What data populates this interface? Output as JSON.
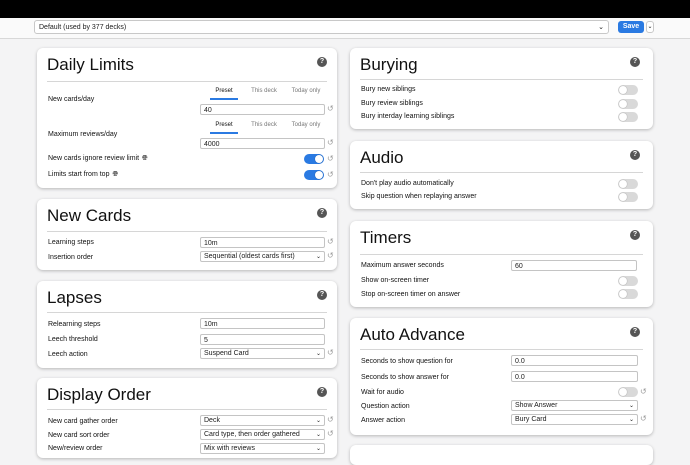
{
  "topbar": {
    "preset": "Default (used by 377 decks)",
    "save_label": "Save",
    "save_menu": "⌄"
  },
  "icons": {
    "help": "help-icon",
    "reset": "revert-icon",
    "globe": "globe-icon",
    "chevron": "chevron-down-icon"
  },
  "colors": {
    "accent": "#2a7ae2"
  },
  "daily_limits": {
    "title": "Daily Limits",
    "tabs": [
      "Preset",
      "This deck",
      "Today only"
    ],
    "new_cards_label": "New cards/day",
    "new_cards_value": "40",
    "max_reviews_label": "Maximum reviews/day",
    "max_reviews_value": "4000",
    "ignore_review_label": "New cards ignore review limit",
    "limits_top_label": "Limits start from top"
  },
  "new_cards": {
    "title": "New Cards",
    "learning_steps_label": "Learning steps",
    "learning_steps_value": "10m",
    "insertion_label": "Insertion order",
    "insertion_value": "Sequential (oldest cards first)"
  },
  "lapses": {
    "title": "Lapses",
    "relearning_label": "Relearning steps",
    "relearning_value": "10m",
    "leech_threshold_label": "Leech threshold",
    "leech_threshold_value": "5",
    "leech_action_label": "Leech action",
    "leech_action_value": "Suspend Card"
  },
  "display_order": {
    "title": "Display Order",
    "gather_label": "New card gather order",
    "gather_value": "Deck",
    "sort_label": "New card sort order",
    "sort_value": "Card type, then order gathered",
    "partial_label": "New/review order",
    "partial_value": "Mix with reviews"
  },
  "burying": {
    "title": "Burying",
    "items": [
      "Bury new siblings",
      "Bury review siblings",
      "Bury interday learning siblings"
    ]
  },
  "audio": {
    "title": "Audio",
    "items": [
      "Don't play audio automatically",
      "Skip question when replaying answer"
    ]
  },
  "timers": {
    "title": "Timers",
    "max_answer_label": "Maximum answer seconds",
    "max_answer_value": "60",
    "show_timer_label": "Show on-screen timer",
    "stop_timer_label": "Stop on-screen timer on answer"
  },
  "auto_advance": {
    "title": "Auto Advance",
    "q_seconds_label": "Seconds to show question for",
    "q_seconds_value": "0.0",
    "a_seconds_label": "Seconds to show answer for",
    "a_seconds_value": "0.0",
    "wait_audio_label": "Wait for audio",
    "question_action_label": "Question action",
    "question_action_value": "Show Answer",
    "answer_action_label": "Answer action",
    "answer_action_value": "Bury Card"
  }
}
